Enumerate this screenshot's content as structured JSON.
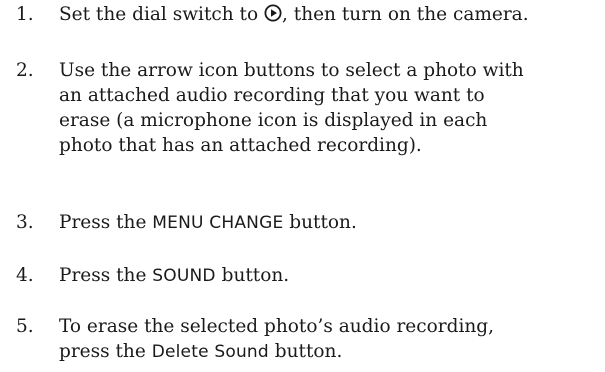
{
  "steps": [
    {
      "number": "1.",
      "before": "Set the dial switch to ",
      "icon": "playback-mode-icon",
      "after": ", then turn on the camera."
    },
    {
      "number": "2.",
      "lines": [
        "Use the arrow icon buttons to select a photo with",
        "an attached audio recording that you want to",
        "erase (a microphone icon is displayed in each",
        "photo that has an attached recording)."
      ]
    },
    {
      "number": "3.",
      "before": "Press the ",
      "button_label": "MENU CHANGE",
      "after": " button."
    },
    {
      "number": "4.",
      "before": "Press the ",
      "button_label": "SOUND",
      "after": " button."
    },
    {
      "number": "5.",
      "line1": "To erase the selected photo’s audio recording,",
      "before": "press the ",
      "button_label": "Delete Sound",
      "after": " button."
    }
  ]
}
